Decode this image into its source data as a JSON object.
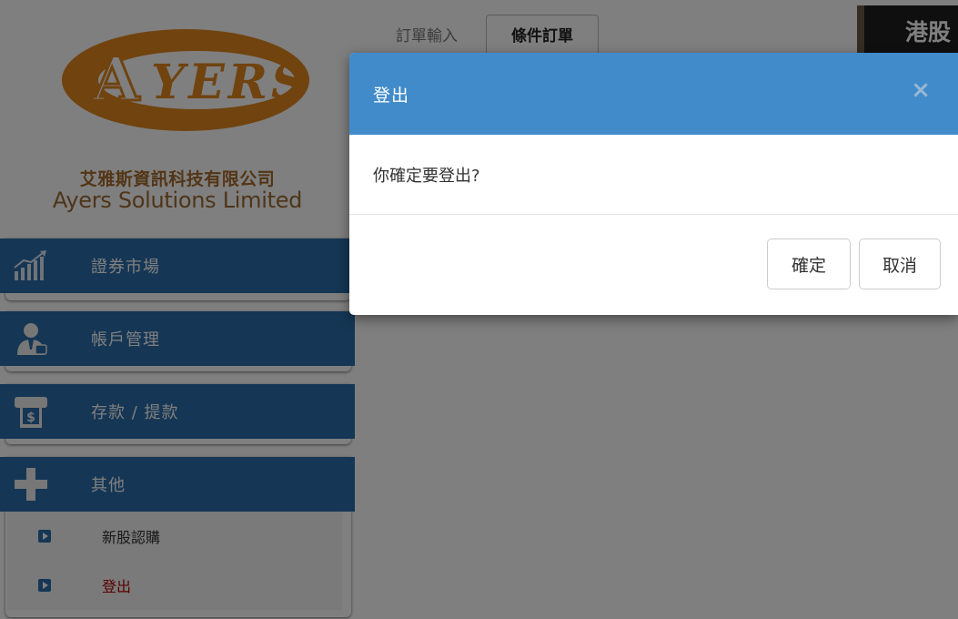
{
  "logo": {
    "brand_text": "AYERS",
    "chinese_name": "艾雅斯資訊科技有限公司",
    "english_name": "Ayers Solutions Limited"
  },
  "sidebar": {
    "menus": [
      {
        "label": "證券市場",
        "icon": "stock-chart-icon"
      },
      {
        "label": "帳戶管理",
        "icon": "account-user-icon"
      },
      {
        "label": "存款 / 提款",
        "icon": "money-transfer-icon"
      },
      {
        "label": "其他",
        "icon": "plus-icon"
      }
    ],
    "submenu": [
      {
        "label": "新股認購",
        "icon": "play-bullet-icon"
      },
      {
        "label": "登出",
        "icon": "play-bullet-icon"
      }
    ]
  },
  "main": {
    "tabs": [
      {
        "label": "訂單輸入"
      },
      {
        "label": "條件訂單"
      }
    ],
    "market_title": "港股"
  },
  "modal": {
    "title": "登出",
    "close_symbol": "×",
    "message": "你確定要登出?",
    "confirm_label": "確定",
    "cancel_label": "取消"
  },
  "colors": {
    "menu_blue": "#2b6caa",
    "modal_header_blue": "#428bca",
    "logo_orange": "#e0871e",
    "logout_red": "#b30000"
  }
}
